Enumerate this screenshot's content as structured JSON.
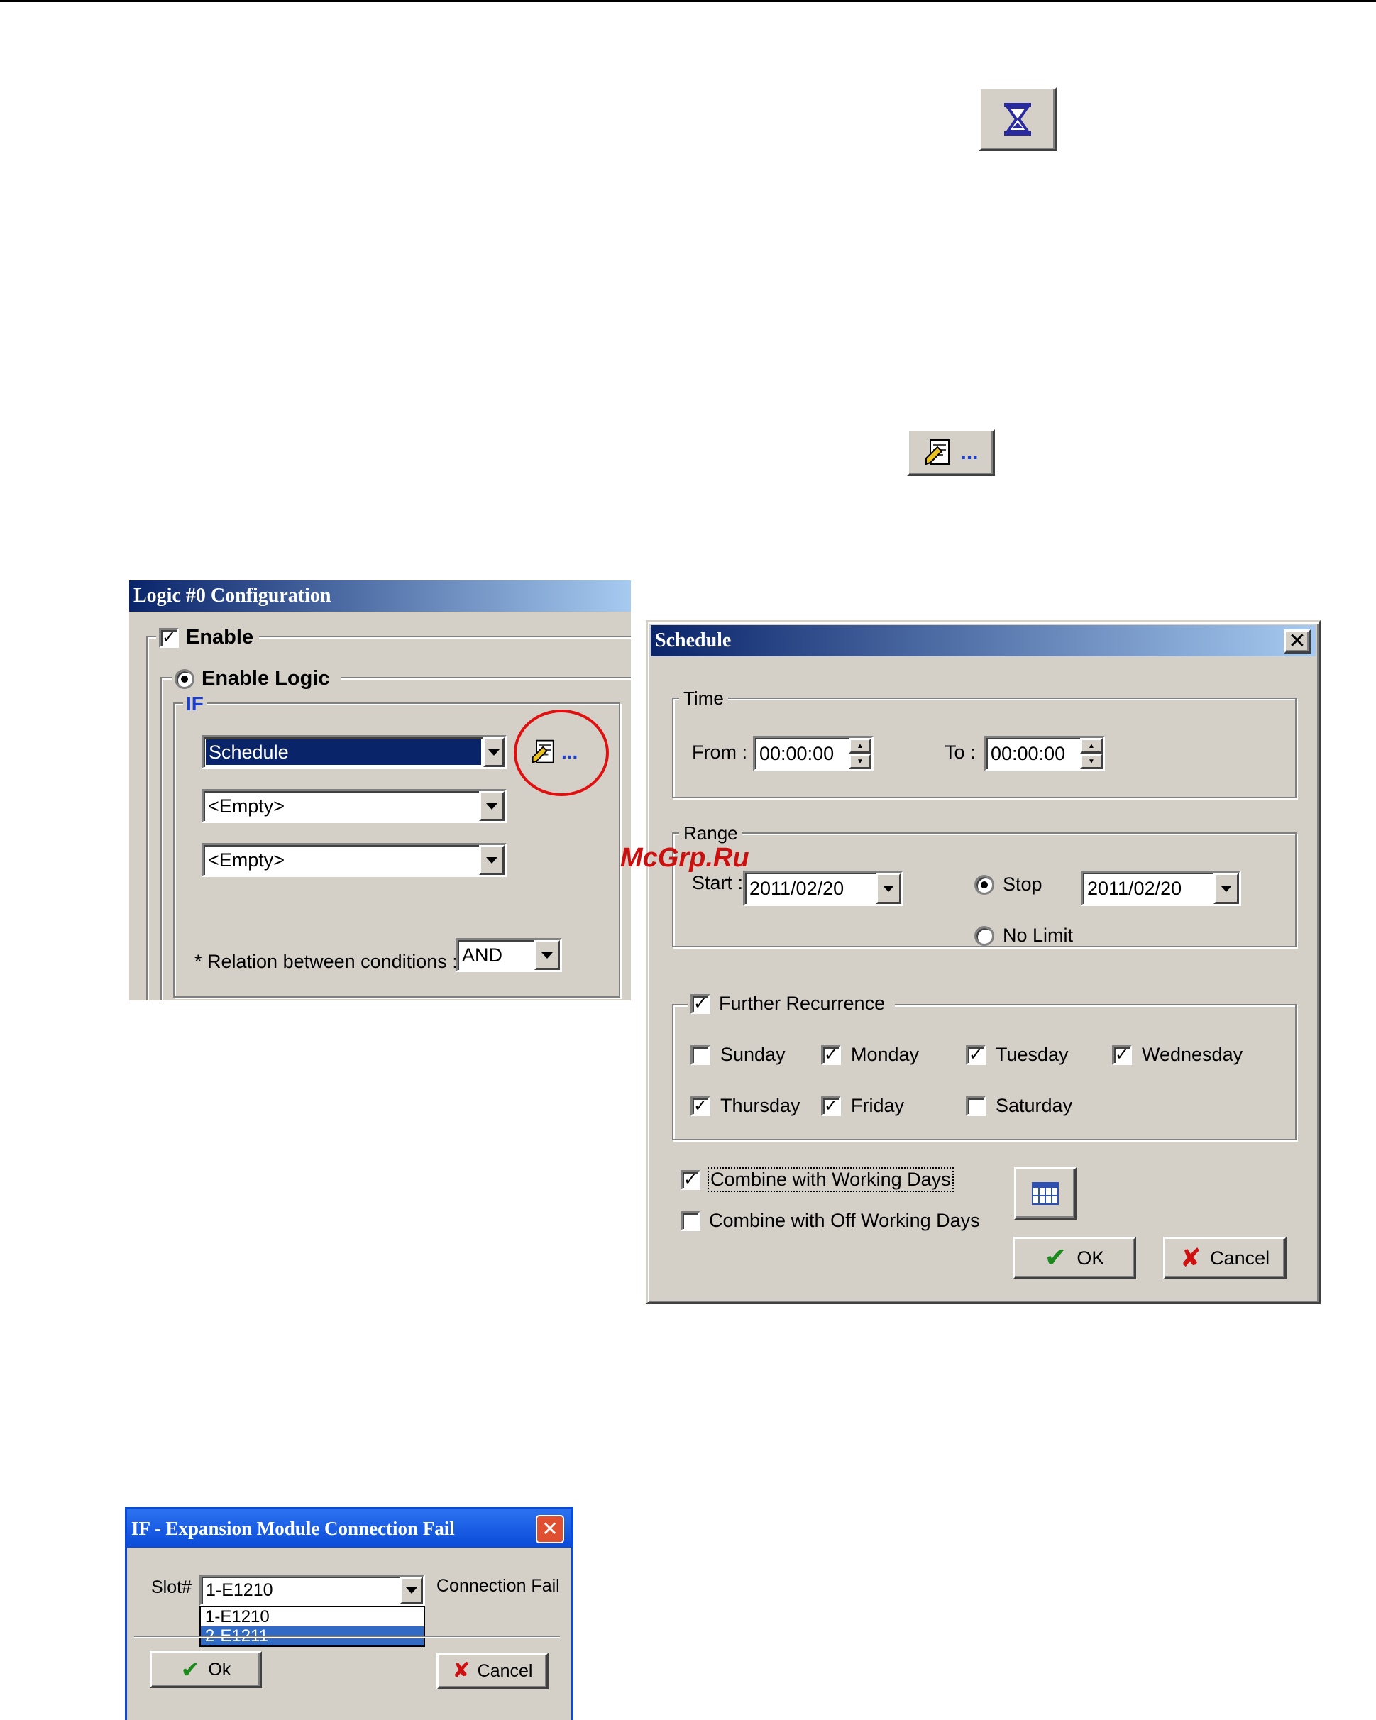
{
  "logic_dialog": {
    "title": "Logic #0 Configuration",
    "enable_label": "Enable",
    "enable_logic_label": "Enable Logic",
    "if_label": "IF",
    "conditions": [
      "Schedule",
      "<Empty>",
      "<Empty>"
    ],
    "relation_label": "* Relation between conditions :",
    "relation_value": "AND",
    "edit_button_text": "..."
  },
  "toolbar_icons": {
    "hourglass_icon": "hourglass-icon",
    "edit_icon_text": "..."
  },
  "watermark": "McGrp.Ru",
  "schedule_dialog": {
    "title": "Schedule",
    "time_group": "Time",
    "from_label": "From :",
    "from_value": "00:00:00",
    "to_label": "To :",
    "to_value": "00:00:00",
    "range_group": "Range",
    "start_label": "Start :",
    "start_value": "2011/02/20",
    "stop_label": "Stop",
    "stop_value": "2011/02/20",
    "no_limit_label": "No Limit",
    "further_recurrence_label": "Further Recurrence",
    "days": {
      "sunday": "Sunday",
      "monday": "Monday",
      "tuesday": "Tuesday",
      "wednesday": "Wednesday",
      "thursday": "Thursday",
      "friday": "Friday",
      "saturday": "Saturday"
    },
    "combine_working_label": "Combine with Working Days",
    "combine_off_label": "Combine with Off Working Days",
    "ok_label": "OK",
    "cancel_label": "Cancel"
  },
  "expansion_dialog": {
    "title": "IF - Expansion Module Connection Fail",
    "slot_label": "Slot#",
    "slot_value": "1-E1210",
    "status_label": "Connection Fail",
    "options": [
      "1-E1210",
      "2-E1211"
    ],
    "ok_label": "Ok",
    "cancel_label": "Cancel"
  }
}
